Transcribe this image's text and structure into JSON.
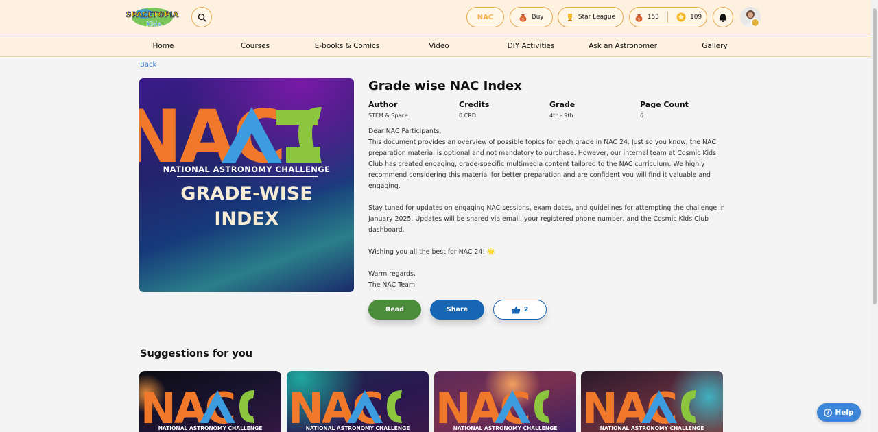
{
  "header": {
    "logo_text_top": "SPACETOPIA",
    "logo_text_bottom": "Kids",
    "nac_label": "NAC",
    "buy_label": "Buy",
    "league_label": "Star League",
    "coins_count": "153",
    "stars_count": "109"
  },
  "nav": {
    "items": [
      {
        "label": "Home"
      },
      {
        "label": "Courses"
      },
      {
        "label": "E-books & Comics"
      },
      {
        "label": "Video"
      },
      {
        "label": "DIY Activities"
      },
      {
        "label": "Ask an Astronomer"
      },
      {
        "label": "Gallery"
      }
    ]
  },
  "back_label": "Back",
  "cover": {
    "logo": "NAC",
    "subtitle": "NATIONAL ASTRONOMY CHALLENGE",
    "title_line1": "GRADE-WISE",
    "title_line2": "INDEX"
  },
  "document": {
    "title": "Grade wise NAC Index",
    "meta": [
      {
        "label": "Author",
        "value": "STEM & Space"
      },
      {
        "label": "Credits",
        "value": "0 CRD"
      },
      {
        "label": "Grade",
        "value": "4th - 9th"
      },
      {
        "label": "Page Count",
        "value": "6"
      }
    ],
    "greeting": "Dear NAC Participants,",
    "para1": "This document provides an overview of possible topics for each grade in NAC 24. Just so you know, the NAC preparation material is optional and not mandatory to purchase. However, our internal team at Cosmic Kids Club has created engaging, grade-specific multimedia content tailored to the NAC curriculum. We highly recommend considering this material for better preparation and are confident you will find it valuable and engaging.",
    "para2": "Stay tuned for updates on engaging NAC sessions, exam dates, and guidelines for attempting the challenge in January 2025. Updates will be shared via email, your registered phone number, and the Cosmic Kids Club dashboard.",
    "wishes": "Wishing you all the best for NAC 24! 🌟",
    "signoff1": "Warm regards,",
    "signoff2": "The NAC Team"
  },
  "actions": {
    "read_label": "Read",
    "share_label": "Share",
    "like_count": "2"
  },
  "suggestions": {
    "title": "Suggestions for you",
    "cards": [
      {
        "logo": "NAC",
        "subtitle": "NATIONAL ASTRONOMY CHALLENGE"
      },
      {
        "logo": "NAC",
        "subtitle": "NATIONAL ASTRONOMY CHALLENGE"
      },
      {
        "logo": "NAC",
        "subtitle": "NATIONAL ASTRONOMY CHALLENGE"
      },
      {
        "logo": "NAC",
        "subtitle": "NATIONAL ASTRONOMY CHALLENGE"
      }
    ]
  },
  "help_label": "Help",
  "colors": {
    "header_bg": "#fef1df",
    "accent_orange": "#e6a84a",
    "read_green": "#4a8c3a",
    "share_blue": "#1766b4",
    "nac_orange": "#f0782a",
    "nac_blue": "#3d9be0",
    "nac_green": "#8cc63f"
  }
}
